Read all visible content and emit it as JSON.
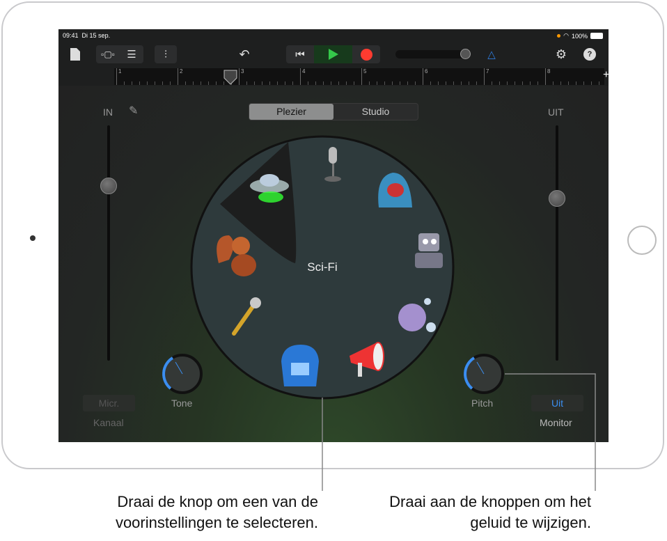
{
  "status": {
    "time": "09:41",
    "date": "Di 15 sep.",
    "battery": "100%"
  },
  "toolbar": {
    "icons": [
      "document-icon",
      "track-view-icon",
      "tracks-list-icon",
      "mixer-icon",
      "undo-icon",
      "rewind-icon",
      "play-icon",
      "record-icon",
      "volume-slider",
      "metronome-icon",
      "settings-icon",
      "help-icon"
    ],
    "accent": "#2f7ee0",
    "play_color": "#35c84a",
    "record_color": "#ff3b30"
  },
  "ruler": {
    "bars": [
      "1",
      "2",
      "3",
      "4",
      "5",
      "6",
      "7",
      "8"
    ],
    "add": "+"
  },
  "input": {
    "label": "IN",
    "level": 0.74,
    "channel_button": "Micr.",
    "channel_label": "Kanaal"
  },
  "output": {
    "label": "UIT",
    "level": 0.69,
    "monitor_button": "Uit",
    "monitor_label": "Monitor"
  },
  "segment": {
    "options": [
      "Plezier",
      "Studio"
    ],
    "selected": "Plezier"
  },
  "dial": {
    "selected": "Sci-Fi",
    "presets": [
      "ufo-icon",
      "microphone-icon",
      "monster-icon",
      "robot-icon",
      "bubbles-icon",
      "megaphone-icon",
      "telephone-icon",
      "handheld-mic-icon",
      "squirrel-icon"
    ]
  },
  "knobs": {
    "tone": {
      "label": "Tone",
      "value": 0.4
    },
    "pitch": {
      "label": "Pitch",
      "value": 0.4
    }
  },
  "callouts": {
    "dial": "Draai de knop om een van de voorinstellingen te selecteren.",
    "knobs": "Draai aan de knoppen om het geluid te wijzigen."
  }
}
